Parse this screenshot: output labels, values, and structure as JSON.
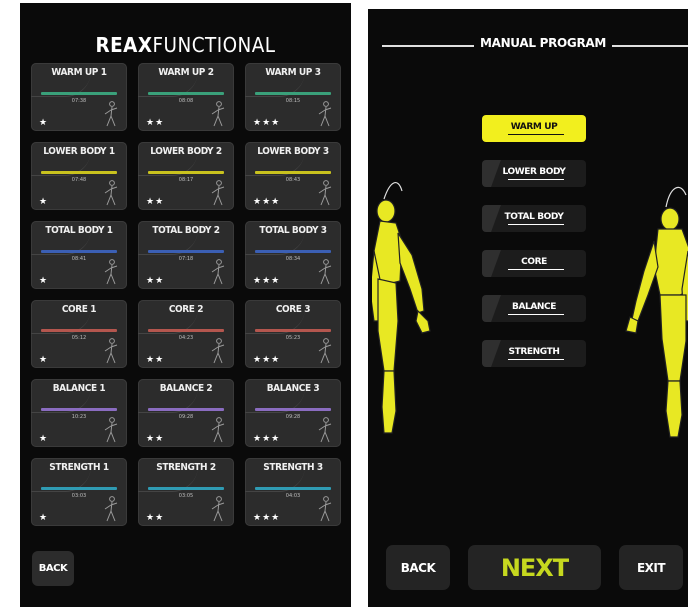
{
  "left_screen": {
    "brand": {
      "prefix": "REAX",
      "suffix": "FUNCTIONAL"
    },
    "cards": [
      {
        "title": "WARM UP 1",
        "time": "07:38",
        "stars": "★",
        "line_color": "#3aa07a"
      },
      {
        "title": "WARM UP 2",
        "time": "08:08",
        "stars": "★★",
        "line_color": "#3aa07a"
      },
      {
        "title": "WARM UP 3",
        "time": "08:15",
        "stars": "★★★",
        "line_color": "#3aa07a"
      },
      {
        "title": "LOWER BODY 1",
        "time": "07:48",
        "stars": "★",
        "line_color": "#c9c21e"
      },
      {
        "title": "LOWER BODY 2",
        "time": "08:17",
        "stars": "★★",
        "line_color": "#c9c21e"
      },
      {
        "title": "LOWER BODY 3",
        "time": "08:43",
        "stars": "★★★",
        "line_color": "#c9c21e"
      },
      {
        "title": "TOTAL BODY 1",
        "time": "08:41",
        "stars": "★",
        "line_color": "#3b5fb4"
      },
      {
        "title": "TOTAL BODY 2",
        "time": "07:18",
        "stars": "★★",
        "line_color": "#3b5fb4"
      },
      {
        "title": "TOTAL BODY 3",
        "time": "08:34",
        "stars": "★★★",
        "line_color": "#3b5fb4"
      },
      {
        "title": "CORE 1",
        "time": "05:12",
        "stars": "★",
        "line_color": "#b4564e"
      },
      {
        "title": "CORE 2",
        "time": "04:23",
        "stars": "★★",
        "line_color": "#b4564e"
      },
      {
        "title": "CORE 3",
        "time": "05:23",
        "stars": "★★★",
        "line_color": "#b4564e"
      },
      {
        "title": "BALANCE 1",
        "time": "10:23",
        "stars": "★",
        "line_color": "#8a6cc0"
      },
      {
        "title": "BALANCE 2",
        "time": "09:28",
        "stars": "★★",
        "line_color": "#8a6cc0"
      },
      {
        "title": "BALANCE 3",
        "time": "09:28",
        "stars": "★★★",
        "line_color": "#8a6cc0"
      },
      {
        "title": "STRENGTH 1",
        "time": "03:03",
        "stars": "★",
        "line_color": "#2f9bb3"
      },
      {
        "title": "STRENGTH 2",
        "time": "03:05",
        "stars": "★★",
        "line_color": "#2f9bb3"
      },
      {
        "title": "STRENGTH 3",
        "time": "04:03",
        "stars": "★★★",
        "line_color": "#2f9bb3"
      }
    ],
    "back_label": "BACK"
  },
  "right_screen": {
    "title": "MANUAL PROGRAM",
    "menu": [
      {
        "label": "WARM UP",
        "active": true
      },
      {
        "label": "LOWER BODY",
        "active": false
      },
      {
        "label": "TOTAL BODY",
        "active": false
      },
      {
        "label": "CORE",
        "active": false
      },
      {
        "label": "BALANCE",
        "active": false
      },
      {
        "label": "STRENGTH",
        "active": false
      }
    ],
    "back_label": "BACK",
    "next_label": "NEXT",
    "exit_label": "EXIT",
    "accent_color": "#f2ef1e",
    "next_color": "#c6d81f",
    "body_icons": [
      "body-front-icon",
      "body-back-icon"
    ]
  }
}
